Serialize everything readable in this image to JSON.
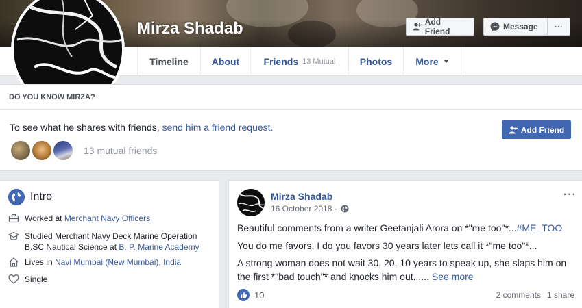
{
  "header": {
    "profile_name": "Mirza Shadab",
    "add_friend_label": "Add Friend",
    "message_label": "Message",
    "more_label": "···"
  },
  "tabs": [
    {
      "label": "Timeline"
    },
    {
      "label": "About"
    },
    {
      "label": "Friends",
      "sub": "13 Mutual"
    },
    {
      "label": "Photos"
    },
    {
      "label": "More"
    }
  ],
  "know_card": {
    "title": "DO YOU KNOW MIRZA?",
    "text": "To see what he shares with friends, ",
    "link_text": "send him a friend request.",
    "mutual_friends": "13 mutual friends",
    "add_friend_label": "Add Friend"
  },
  "intro": {
    "title": "Intro",
    "worked_prefix": "Worked at ",
    "worked_link": "Merchant Navy Officers",
    "studied_line1": "Studied Merchant Navy Deck Marine Operation",
    "studied_line2_prefix": "B.SC Nautical Science at ",
    "studied_link": "B. P. Marine Academy",
    "lives_prefix": "Lives in ",
    "lives_link": "Navi Mumbai (New Mumbai), India",
    "relationship": "Single"
  },
  "post": {
    "author": "Mirza Shadab",
    "date": "16 October 2018 ·",
    "menu": "···",
    "p1_text": "Beautiful comments from a writer Geetanjali Arora on *\"me too\"*...",
    "p1_link": "#ME_TOO",
    "p2_text": "You do me favors, I do you favors 30 years later lets call it *\"me too\"*...",
    "p3_text": "A strong woman does not wait 30, 20, 10 years to speak up, she slaps him on the first *\"bad touch\"* and knocks him out...... ",
    "p3_link": "See more",
    "likes": "10",
    "comments": "2 comments",
    "shares": "1 share"
  },
  "colors": {
    "link": "#365899",
    "button_blue": "#4267b2",
    "background": "#e9ebee"
  },
  "icons": [
    "add-friend-icon",
    "messenger-icon",
    "globe-icon",
    "briefcase-icon",
    "graduation-cap-icon",
    "home-icon",
    "heart-icon",
    "public-globe-icon",
    "like-icon"
  ]
}
